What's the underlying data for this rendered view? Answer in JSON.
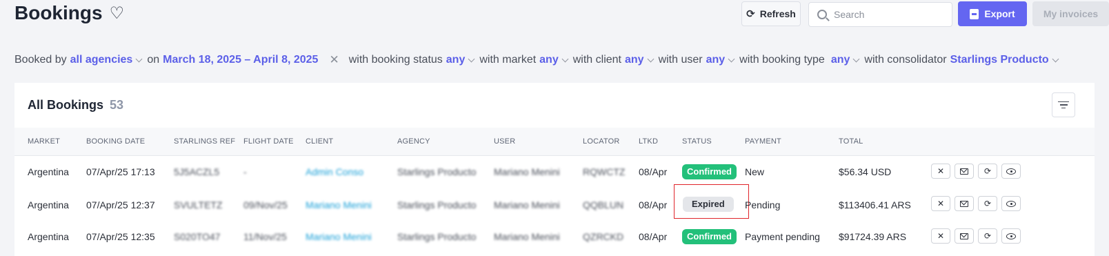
{
  "header": {
    "title": "Bookings",
    "refresh_label": "Refresh",
    "search_placeholder": "Search",
    "export_label": "Export",
    "invoices_label": "My invoices"
  },
  "filters": {
    "booked_by": "Booked by",
    "agencies": "all agencies",
    "on": "on",
    "date_range": "March 18, 2025 – April 8, 2025",
    "status_label": "with booking status",
    "status_value": "any",
    "market_label": "with market",
    "market_value": "any",
    "client_label": "with client",
    "client_value": "any",
    "user_label": "with user",
    "user_value": "any",
    "type_label": "with booking type",
    "type_value": "any",
    "consolidator_label": "with consolidator",
    "consolidator_value": "Starlings Producto"
  },
  "table": {
    "title": "All Bookings",
    "count": "53",
    "columns": [
      "MARKET",
      "BOOKING DATE",
      "STARLINGS REF",
      "FLIGHT DATE",
      "CLIENT",
      "AGENCY",
      "USER",
      "LOCATOR",
      "LTKD",
      "STATUS",
      "PAYMENT",
      "TOTAL"
    ],
    "rows": [
      {
        "market": "Argentina",
        "booking_date": "07/Apr/25 17:13",
        "ref": "5J5ACZL5",
        "flight_date": "-",
        "client": "Admin Conso",
        "agency": "Starlings Producto",
        "user": "Mariano Menini",
        "locator": "RQWCTZ",
        "ltkd": "08/Apr",
        "status": "Confirmed",
        "payment": "New",
        "total": "$56.34 USD"
      },
      {
        "market": "Argentina",
        "booking_date": "07/Apr/25 12:37",
        "ref": "SVULTETZ",
        "flight_date": "09/Nov/25",
        "client": "Mariano Menini",
        "agency": "Starlings Producto",
        "user": "Mariano Menini",
        "locator": "QQBLUN",
        "ltkd": "08/Apr",
        "status": "Expired",
        "payment": "Pending",
        "total": "$113406.41 ARS"
      },
      {
        "market": "Argentina",
        "booking_date": "07/Apr/25 12:35",
        "ref": "S020TO47",
        "flight_date": "11/Nov/25",
        "client": "Mariano Menini",
        "agency": "Starlings Producto",
        "user": "Mariano Menini",
        "locator": "QZRCKD",
        "ltkd": "08/Apr",
        "status": "Confirmed",
        "payment": "Payment pending",
        "total": "$91724.39 ARS"
      }
    ]
  },
  "icons": [
    "heart-icon",
    "refresh-icon",
    "search-icon",
    "export-icon",
    "clear-icon",
    "filter-icon",
    "cancel-icon",
    "mail-icon",
    "sync-icon",
    "view-icon"
  ],
  "colors": {
    "accent": "#6466f1",
    "link": "#1aa0d8",
    "confirmed": "#23c07a",
    "expired": "#e4e6ea",
    "highlight": "#e0242a"
  }
}
